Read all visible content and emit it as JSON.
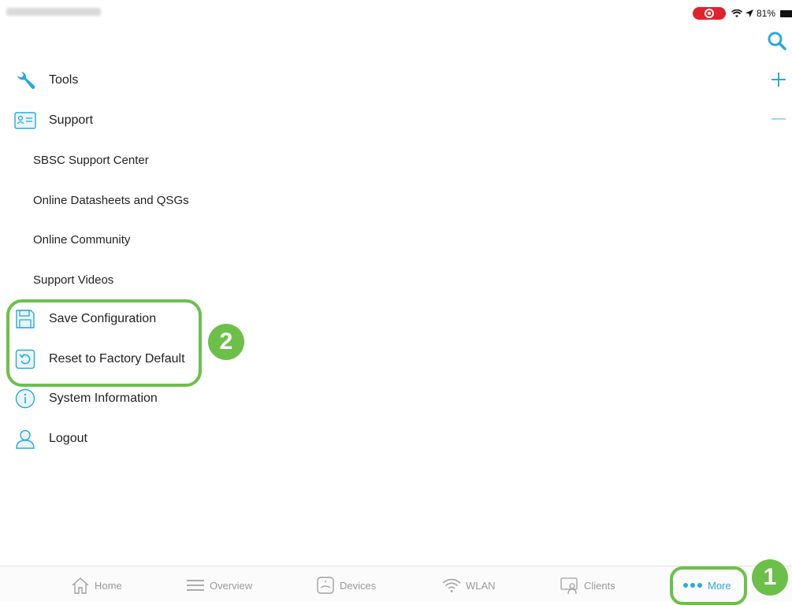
{
  "status_bar": {
    "battery_text": "81%"
  },
  "top_actions": {
    "search_icon": "search-icon",
    "plus_icon": "plus-icon",
    "minus_icon": "minus-icon"
  },
  "menu": {
    "tools": "Tools",
    "support": "Support",
    "support_items": [
      "SBSC Support Center",
      "Online Datasheets and QSGs",
      "Online Community",
      "Support Videos"
    ],
    "save_configuration": "Save Configuration",
    "reset_factory_default": "Reset to Factory Default",
    "system_information": "System Information",
    "logout": "Logout"
  },
  "annotations": {
    "step_1": "1",
    "step_2": "2"
  },
  "tab_bar": {
    "tabs": [
      {
        "label": "Home",
        "icon": "home-icon"
      },
      {
        "label": "Overview",
        "icon": "list-icon"
      },
      {
        "label": "Devices",
        "icon": "device-icon"
      },
      {
        "label": "WLAN",
        "icon": "wifi-icon"
      },
      {
        "label": "Clients",
        "icon": "clients-icon"
      },
      {
        "label": "More",
        "icon": "more-dots-icon"
      }
    ],
    "active": "More"
  },
  "colors": {
    "accent": "#29a9df",
    "annotation": "#6cc04a",
    "record_pill": "#e0232b"
  }
}
